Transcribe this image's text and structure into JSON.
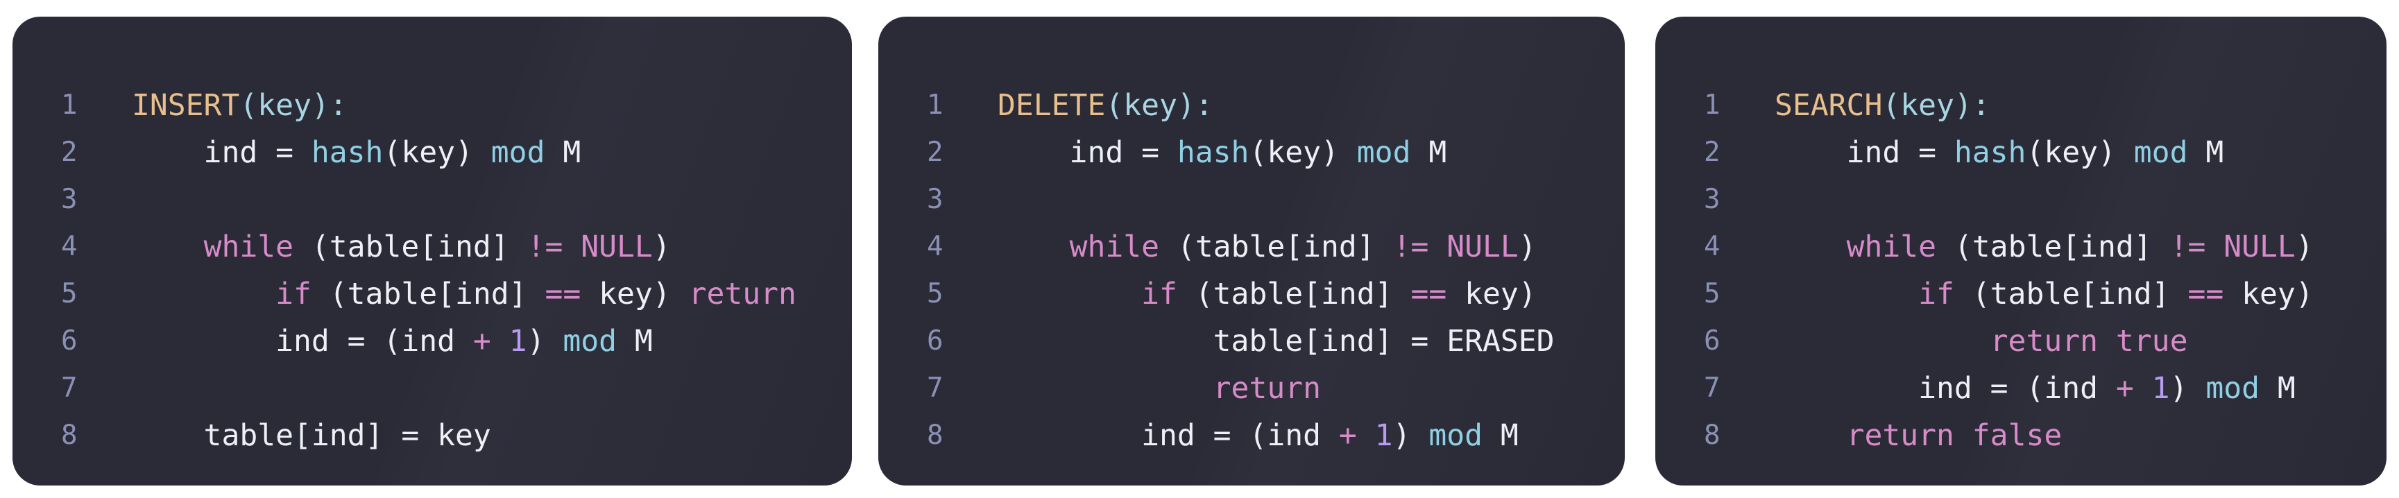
{
  "panels": [
    {
      "name": "insert",
      "lines": [
        {
          "n": "1",
          "tokens": [
            {
              "t": "INSERT",
              "c": "fn"
            },
            {
              "t": "(",
              "c": "paren"
            },
            {
              "t": "key",
              "c": "paren"
            },
            {
              "t": "):",
              "c": "paren"
            }
          ]
        },
        {
          "n": "2",
          "tokens": [
            {
              "t": "    ind = ",
              "c": "var"
            },
            {
              "t": "hash",
              "c": "call"
            },
            {
              "t": "(key) ",
              "c": "var"
            },
            {
              "t": "mod",
              "c": "call"
            },
            {
              "t": " M",
              "c": "var"
            }
          ]
        },
        {
          "n": "3",
          "tokens": []
        },
        {
          "n": "4",
          "tokens": [
            {
              "t": "    ",
              "c": "var"
            },
            {
              "t": "while",
              "c": "kw"
            },
            {
              "t": " (table[ind] ",
              "c": "var"
            },
            {
              "t": "!=",
              "c": "kw"
            },
            {
              "t": " ",
              "c": "var"
            },
            {
              "t": "NULL",
              "c": "kw"
            },
            {
              "t": ")",
              "c": "var"
            }
          ]
        },
        {
          "n": "5",
          "tokens": [
            {
              "t": "        ",
              "c": "var"
            },
            {
              "t": "if",
              "c": "kw"
            },
            {
              "t": " (table[ind] ",
              "c": "var"
            },
            {
              "t": "==",
              "c": "kw"
            },
            {
              "t": " key) ",
              "c": "var"
            },
            {
              "t": "return",
              "c": "kw"
            }
          ]
        },
        {
          "n": "6",
          "tokens": [
            {
              "t": "        ind = (ind ",
              "c": "var"
            },
            {
              "t": "+",
              "c": "kw"
            },
            {
              "t": " ",
              "c": "var"
            },
            {
              "t": "1",
              "c": "num"
            },
            {
              "t": ") ",
              "c": "var"
            },
            {
              "t": "mod",
              "c": "call"
            },
            {
              "t": " M",
              "c": "var"
            }
          ]
        },
        {
          "n": "7",
          "tokens": []
        },
        {
          "n": "8",
          "tokens": [
            {
              "t": "    table[ind] = key",
              "c": "var"
            }
          ]
        }
      ]
    },
    {
      "name": "delete",
      "lines": [
        {
          "n": "1",
          "tokens": [
            {
              "t": "DELETE",
              "c": "fn"
            },
            {
              "t": "(",
              "c": "paren"
            },
            {
              "t": "key",
              "c": "paren"
            },
            {
              "t": "):",
              "c": "paren"
            }
          ]
        },
        {
          "n": "2",
          "tokens": [
            {
              "t": "    ind = ",
              "c": "var"
            },
            {
              "t": "hash",
              "c": "call"
            },
            {
              "t": "(key) ",
              "c": "var"
            },
            {
              "t": "mod",
              "c": "call"
            },
            {
              "t": " M",
              "c": "var"
            }
          ]
        },
        {
          "n": "3",
          "tokens": []
        },
        {
          "n": "4",
          "tokens": [
            {
              "t": "    ",
              "c": "var"
            },
            {
              "t": "while",
              "c": "kw"
            },
            {
              "t": " (table[ind] ",
              "c": "var"
            },
            {
              "t": "!=",
              "c": "kw"
            },
            {
              "t": " ",
              "c": "var"
            },
            {
              "t": "NULL",
              "c": "kw"
            },
            {
              "t": ")",
              "c": "var"
            }
          ]
        },
        {
          "n": "5",
          "tokens": [
            {
              "t": "        ",
              "c": "var"
            },
            {
              "t": "if",
              "c": "kw"
            },
            {
              "t": " (table[ind] ",
              "c": "var"
            },
            {
              "t": "==",
              "c": "kw"
            },
            {
              "t": " key)",
              "c": "var"
            }
          ]
        },
        {
          "n": "6",
          "tokens": [
            {
              "t": "            table[ind] = ERASED",
              "c": "var"
            }
          ]
        },
        {
          "n": "7",
          "tokens": [
            {
              "t": "            ",
              "c": "var"
            },
            {
              "t": "return",
              "c": "kw"
            }
          ]
        },
        {
          "n": "8",
          "tokens": [
            {
              "t": "        ind = (ind ",
              "c": "var"
            },
            {
              "t": "+",
              "c": "kw"
            },
            {
              "t": " ",
              "c": "var"
            },
            {
              "t": "1",
              "c": "num"
            },
            {
              "t": ") ",
              "c": "var"
            },
            {
              "t": "mod",
              "c": "call"
            },
            {
              "t": " M",
              "c": "var"
            }
          ]
        }
      ]
    },
    {
      "name": "search",
      "lines": [
        {
          "n": "1",
          "tokens": [
            {
              "t": "SEARCH",
              "c": "fn"
            },
            {
              "t": "(",
              "c": "paren"
            },
            {
              "t": "key",
              "c": "paren"
            },
            {
              "t": "):",
              "c": "paren"
            }
          ]
        },
        {
          "n": "2",
          "tokens": [
            {
              "t": "    ind = ",
              "c": "var"
            },
            {
              "t": "hash",
              "c": "call"
            },
            {
              "t": "(key) ",
              "c": "var"
            },
            {
              "t": "mod",
              "c": "call"
            },
            {
              "t": " M",
              "c": "var"
            }
          ]
        },
        {
          "n": "3",
          "tokens": []
        },
        {
          "n": "4",
          "tokens": [
            {
              "t": "    ",
              "c": "var"
            },
            {
              "t": "while",
              "c": "kw"
            },
            {
              "t": " (table[ind] ",
              "c": "var"
            },
            {
              "t": "!=",
              "c": "kw"
            },
            {
              "t": " ",
              "c": "var"
            },
            {
              "t": "NULL",
              "c": "kw"
            },
            {
              "t": ")",
              "c": "var"
            }
          ]
        },
        {
          "n": "5",
          "tokens": [
            {
              "t": "        ",
              "c": "var"
            },
            {
              "t": "if",
              "c": "kw"
            },
            {
              "t": " (table[ind] ",
              "c": "var"
            },
            {
              "t": "==",
              "c": "kw"
            },
            {
              "t": " key)",
              "c": "var"
            }
          ]
        },
        {
          "n": "6",
          "tokens": [
            {
              "t": "            ",
              "c": "var"
            },
            {
              "t": "return",
              "c": "kw"
            },
            {
              "t": " ",
              "c": "var"
            },
            {
              "t": "true",
              "c": "kw"
            }
          ]
        },
        {
          "n": "7",
          "tokens": [
            {
              "t": "        ind = (ind ",
              "c": "var"
            },
            {
              "t": "+",
              "c": "kw"
            },
            {
              "t": " ",
              "c": "var"
            },
            {
              "t": "1",
              "c": "num"
            },
            {
              "t": ") ",
              "c": "var"
            },
            {
              "t": "mod",
              "c": "call"
            },
            {
              "t": " M",
              "c": "var"
            }
          ]
        },
        {
          "n": "8",
          "tokens": [
            {
              "t": "    ",
              "c": "var"
            },
            {
              "t": "return",
              "c": "kw"
            },
            {
              "t": " ",
              "c": "var"
            },
            {
              "t": "false",
              "c": "kw"
            }
          ]
        }
      ]
    }
  ],
  "colors": {
    "background": "#2b2b38",
    "line_number": "#8a91b4",
    "function_name": "#e9c08b",
    "keyword": "#d78bc8",
    "builtin": "#8fd0e4",
    "number": "#b79bf0",
    "text": "#eef0f6"
  }
}
